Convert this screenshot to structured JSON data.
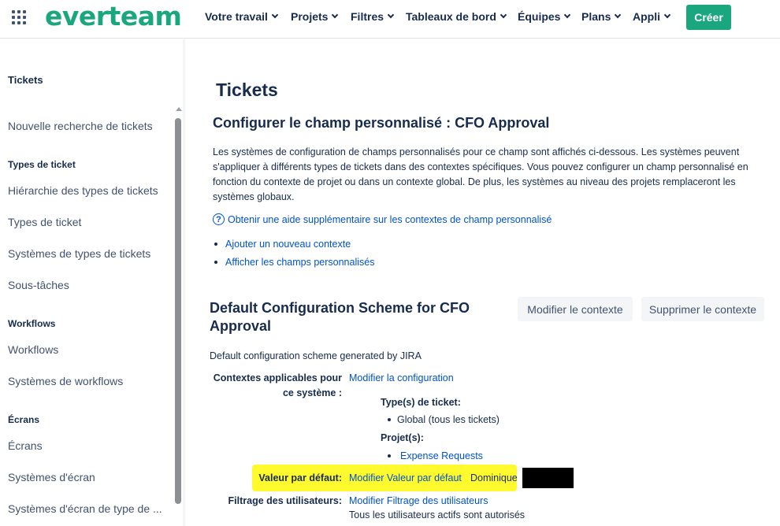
{
  "brand": {
    "logo_text": "everteam",
    "accent": "#1aa77e"
  },
  "topnav": {
    "items": [
      {
        "label": "Votre travail"
      },
      {
        "label": "Projets"
      },
      {
        "label": "Filtres"
      },
      {
        "label": "Tableaux de bord"
      },
      {
        "label": "Équipes"
      },
      {
        "label": "Plans"
      },
      {
        "label": "Appli"
      }
    ],
    "create_label": "Créer"
  },
  "sidebar": {
    "title": "Tickets",
    "new_search": "Nouvelle recherche de tickets",
    "section_ticket_types": "Types de ticket",
    "ticket_type_hierarchy": "Hiérarchie des types de tickets",
    "ticket_types": "Types de ticket",
    "ticket_type_schemes": "Systèmes de types de tickets",
    "subtasks": "Sous-tâches",
    "section_workflows": "Workflows",
    "workflows": "Workflows",
    "workflow_schemes": "Systèmes de workflows",
    "section_screens": "Écrans",
    "screens": "Écrans",
    "screen_schemes": "Systèmes d'écran",
    "issue_type_screen_schemes": "Systèmes d'écran de type de ..."
  },
  "main": {
    "title": "Tickets",
    "subtitle": "Configurer le champ personnalisé : CFO Approval",
    "description": "Les systèmes de configuration de champs personnalisés pour ce champ sont affichés ci-dessous. Les systèmes peuvent s'appliquer à différents types de tickets dans des contextes spécifiques. Vous pouvez configurer un champ personnalisé en fonction du contexte de projet ou dans un contexte global. De plus, les systèmes au niveau des projets remplaceront les systèmes globaux.",
    "help_link": "Obtenir une aide supplémentaire sur les contextes de champ personnalisé",
    "add_context_link": "Ajouter un nouveau contexte",
    "view_fields_link": "Afficher les champs personnalisés",
    "scheme": {
      "title": "Default Configuration Scheme for CFO Approval",
      "edit_context_btn": "Modifier le contexte",
      "delete_context_btn": "Supprimer le contexte",
      "description": "Default configuration scheme generated by JIRA",
      "applicable_contexts_label": "Contextes applicables pour ce système :",
      "edit_config_link": "Modifier la configuration",
      "ticket_types_label": "Type(s) de ticket:",
      "ticket_types_value": "Global (tous les tickets)",
      "projects_label": "Projet(s):",
      "project_link": "Expense Requests",
      "default_value_label": "Valeur par défaut:",
      "default_value_link": "Modifier Valeur par défaut",
      "default_value": "Dominique",
      "user_filter_label": "Filtrage des utilisateurs:",
      "user_filter_link": "Modifier Filtrage des utilisateurs",
      "user_filter_value": "Tous les utilisateurs actifs sont autorisés"
    }
  },
  "colors": {
    "link": "#0052cc",
    "highlight": "#fffa2e",
    "text": "#172b4d"
  }
}
